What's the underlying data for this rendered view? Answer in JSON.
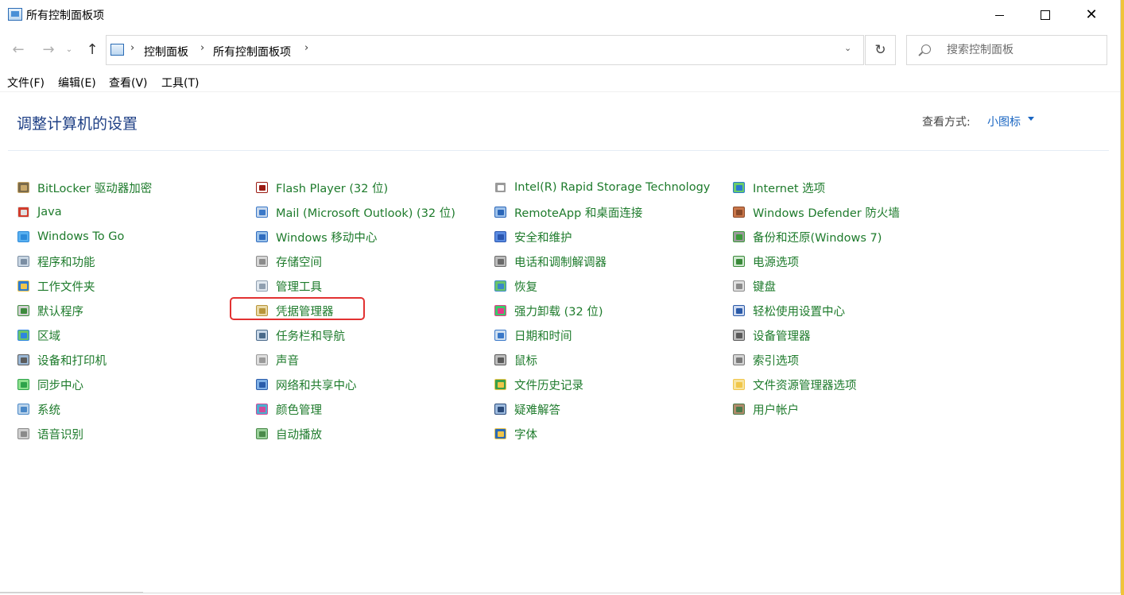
{
  "window": {
    "title": "所有控制面板项",
    "close_glyph": "✕"
  },
  "nav": {
    "back_glyph": "←",
    "forward_glyph": "→",
    "recent_glyph": "⌄",
    "up_glyph": "↑",
    "refresh_glyph": "↻",
    "breadcrumb": [
      "控制面板",
      "所有控制面板项"
    ],
    "separator": "›",
    "dropdown_glyph": "⌄",
    "search_placeholder": "搜索控制面板"
  },
  "menu": [
    "文件(F)",
    "编辑(E)",
    "查看(V)",
    "工具(T)"
  ],
  "header": {
    "title": "调整计算机的设置",
    "view_label": "查看方式:",
    "view_value": "小图标"
  },
  "columns": [
    [
      {
        "label": "BitLocker 驱动器加密",
        "icon": "bitlocker-icon",
        "c1": "#c9a86a",
        "c2": "#7a6a4a"
      },
      {
        "label": "Java",
        "icon": "java-icon",
        "c1": "#e1e1e1",
        "c2": "#d23c2c"
      },
      {
        "label": "Windows To Go",
        "icon": "windows-to-go-icon",
        "c1": "#2d8ad9",
        "c2": "#59b0f0"
      },
      {
        "label": "程序和功能",
        "icon": "programs-icon",
        "c1": "#7b8ea3",
        "c2": "#c9d6e3"
      },
      {
        "label": "工作文件夹",
        "icon": "work-folders-icon",
        "c1": "#f0c64a",
        "c2": "#2c7bd4"
      },
      {
        "label": "默认程序",
        "icon": "default-programs-icon",
        "c1": "#3d8b3d",
        "c2": "#d0d0d0"
      },
      {
        "label": "区域",
        "icon": "region-icon",
        "c1": "#2e86de",
        "c2": "#6ac46a"
      },
      {
        "label": "设备和打印机",
        "icon": "devices-printers-icon",
        "c1": "#5c5c5c",
        "c2": "#9bb8d6"
      },
      {
        "label": "同步中心",
        "icon": "sync-center-icon",
        "c1": "#2ea34a",
        "c2": "#8ee08e"
      },
      {
        "label": "系统",
        "icon": "system-icon",
        "c1": "#4a88c7",
        "c2": "#bcd4ea"
      },
      {
        "label": "语音识别",
        "icon": "speech-icon",
        "c1": "#8a8a8a",
        "c2": "#cfcfcf"
      }
    ],
    [
      {
        "label": "Flash Player (32 位)",
        "icon": "flash-player-icon",
        "c1": "#9a1a12",
        "c2": "#ffffff"
      },
      {
        "label": "Mail (Microsoft Outlook) (32 位)",
        "icon": "mail-icon",
        "c1": "#3a78c8",
        "c2": "#c8d8ec"
      },
      {
        "label": "Windows 移动中心",
        "icon": "mobility-center-icon",
        "c1": "#2f6cbf",
        "c2": "#9bc2ea"
      },
      {
        "label": "存储空间",
        "icon": "storage-spaces-icon",
        "c1": "#8c8c8c",
        "c2": "#d6d6d6"
      },
      {
        "label": "管理工具",
        "icon": "admin-tools-icon",
        "c1": "#8f9fb0",
        "c2": "#e1e8ef"
      },
      {
        "label": "凭据管理器",
        "icon": "credential-manager-icon",
        "c1": "#b9963a",
        "c2": "#e9d9a8"
      },
      {
        "label": "任务栏和导航",
        "icon": "taskbar-icon",
        "c1": "#4b6b8b",
        "c2": "#c9d8e8"
      },
      {
        "label": "声音",
        "icon": "sound-icon",
        "c1": "#9a9a9a",
        "c2": "#dedede"
      },
      {
        "label": "网络和共享中心",
        "icon": "network-icon",
        "c1": "#2a5caa",
        "c2": "#7fb0e6"
      },
      {
        "label": "颜色管理",
        "icon": "color-management-icon",
        "c1": "#d04a9a",
        "c2": "#4ab0d0"
      },
      {
        "label": "自动播放",
        "icon": "autoplay-icon",
        "c1": "#4a8a4a",
        "c2": "#9ad09a"
      }
    ],
    [
      {
        "label": "Intel(R) Rapid Storage Technology",
        "icon": "intel-rst-icon",
        "c1": "#ffffff",
        "c2": "#9a9a9a"
      },
      {
        "label": "RemoteApp 和桌面连接",
        "icon": "remoteapp-icon",
        "c1": "#2b66b8",
        "c2": "#9fc2ea"
      },
      {
        "label": "安全和维护",
        "icon": "security-maintenance-icon",
        "c1": "#2a56b0",
        "c2": "#5a8ae0"
      },
      {
        "label": "电话和调制解调器",
        "icon": "phone-modem-icon",
        "c1": "#6a6a6a",
        "c2": "#bcbcbc"
      },
      {
        "label": "恢复",
        "icon": "recovery-icon",
        "c1": "#3a88c8",
        "c2": "#6ac46a"
      },
      {
        "label": "强力卸载 (32 位)",
        "icon": "uninstaller-icon",
        "c1": "#e43a8a",
        "c2": "#3acb6a"
      },
      {
        "label": "日期和时间",
        "icon": "date-time-icon",
        "c1": "#3a78c8",
        "c2": "#d0e0f0"
      },
      {
        "label": "鼠标",
        "icon": "mouse-icon",
        "c1": "#5a5a5a",
        "c2": "#bdbdbd"
      },
      {
        "label": "文件历史记录",
        "icon": "file-history-icon",
        "c1": "#f0c64a",
        "c2": "#3aa04a"
      },
      {
        "label": "疑难解答",
        "icon": "troubleshooting-icon",
        "c1": "#2a4a7a",
        "c2": "#9fbcdf"
      },
      {
        "label": "字体",
        "icon": "fonts-icon",
        "c1": "#f0c64a",
        "c2": "#2a6ab8"
      }
    ],
    [
      {
        "label": "Internet 选项",
        "icon": "internet-options-icon",
        "c1": "#2a7ad0",
        "c2": "#6acb6a"
      },
      {
        "label": "Windows Defender 防火墙",
        "icon": "firewall-icon",
        "c1": "#8a4a2a",
        "c2": "#c9764a"
      },
      {
        "label": "备份和还原(Windows 7)",
        "icon": "backup-restore-icon",
        "c1": "#3a9a3a",
        "c2": "#9a9a9a"
      },
      {
        "label": "电源选项",
        "icon": "power-options-icon",
        "c1": "#3a8a3a",
        "c2": "#cfe8cf"
      },
      {
        "label": "键盘",
        "icon": "keyboard-icon",
        "c1": "#8a8a8a",
        "c2": "#e0e0e0"
      },
      {
        "label": "轻松使用设置中心",
        "icon": "ease-of-access-icon",
        "c1": "#2a5aa8",
        "c2": "#cfdaf0"
      },
      {
        "label": "设备管理器",
        "icon": "device-manager-icon",
        "c1": "#5a5a5a",
        "c2": "#bcbcbc"
      },
      {
        "label": "索引选项",
        "icon": "indexing-options-icon",
        "c1": "#7a7a7a",
        "c2": "#d4d4d4"
      },
      {
        "label": "文件资源管理器选项",
        "icon": "explorer-options-icon",
        "c1": "#f0c64a",
        "c2": "#f7e4a0"
      },
      {
        "label": "用户帐户",
        "icon": "user-accounts-icon",
        "c1": "#4a7a4a",
        "c2": "#b08a6a"
      }
    ]
  ],
  "colors": {
    "link_green": "#1e7b2c",
    "title_blue": "#1e3f85",
    "highlight_red": "#e23232"
  }
}
